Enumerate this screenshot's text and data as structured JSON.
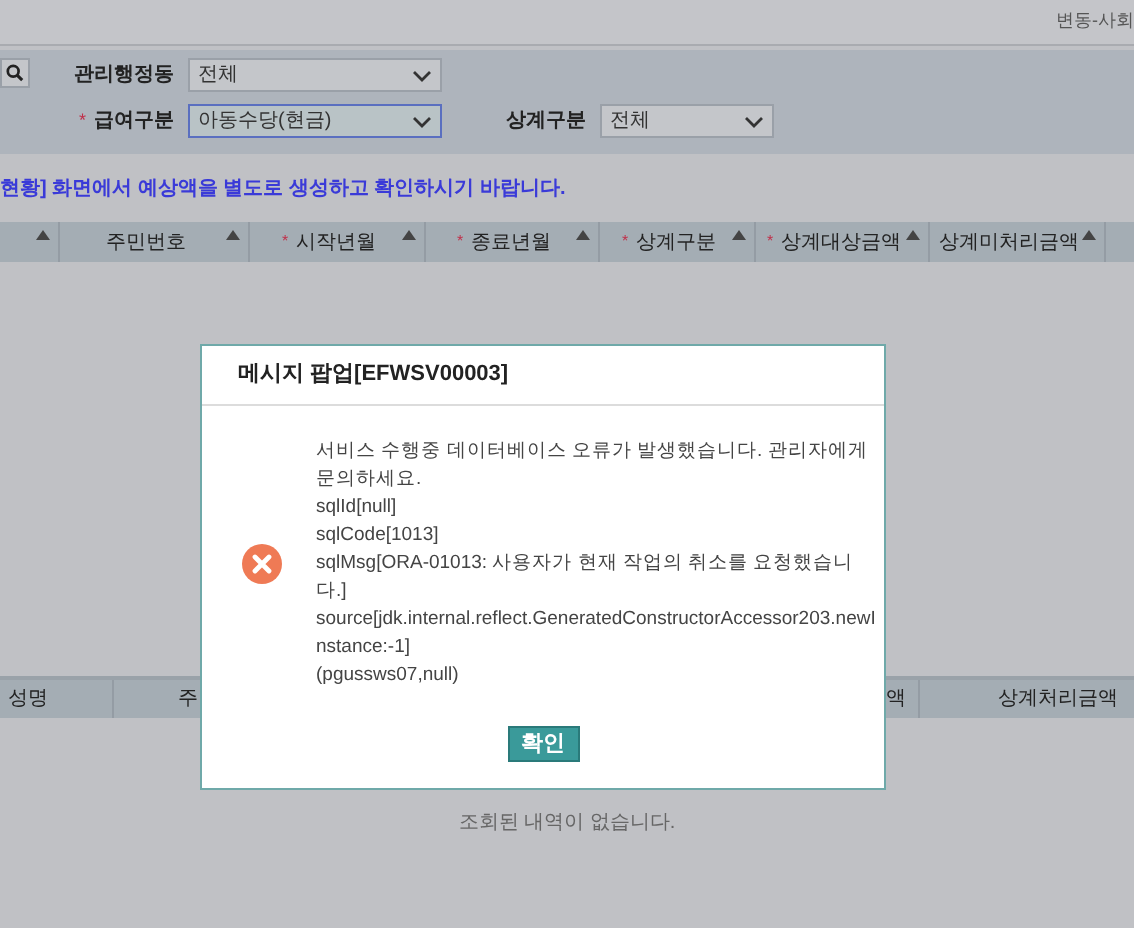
{
  "top_bar": {
    "breadcrumb": "변동-사회"
  },
  "filters": [
    {
      "label": "관리행정동",
      "value": "전체",
      "focused": false
    },
    {
      "required_mark": "*",
      "label": "급여구분",
      "value": "아동수당(현금)",
      "focused": true
    },
    {
      "label": "상계구분",
      "value": "전체",
      "focused": false
    }
  ],
  "notice": "현황] 화면에서 예상액을 별도로 생성하고 확인하시기 바랍니다.",
  "table": {
    "columns": [
      {},
      {
        "label": "주민번호"
      },
      {
        "required_mark": "*",
        "label": "시작년월"
      },
      {
        "required_mark": "*",
        "label": "종료년월"
      },
      {
        "required_mark": "*",
        "label": "상계구분"
      },
      {
        "required_mark": "*",
        "label": "상계대상금액"
      },
      {
        "label": "상계미처리금액"
      }
    ]
  },
  "table_2": {
    "columns": [
      "성명",
      "주",
      "액",
      "상계처리금액"
    ],
    "empty_message": "조회된 내역이 없습니다."
  },
  "dialog": {
    "title": "메시지 팝업[EFWSV00003]",
    "kind": "error",
    "message": [
      "서비스 수행중 데이터베이스 오류가 발생했습니다. 관리자에게 문의하세요.",
      "sqlId[null]",
      "sqlCode[1013]",
      "sqlMsg[ORA-01013: 사용자가 현재 작업의 취소를 요청했습니다.]",
      "source[jdk.internal.reflect.GeneratedConstructorAccessor203.newInstance:-1]",
      "(pgussws07,null)"
    ],
    "button": "확인"
  }
}
